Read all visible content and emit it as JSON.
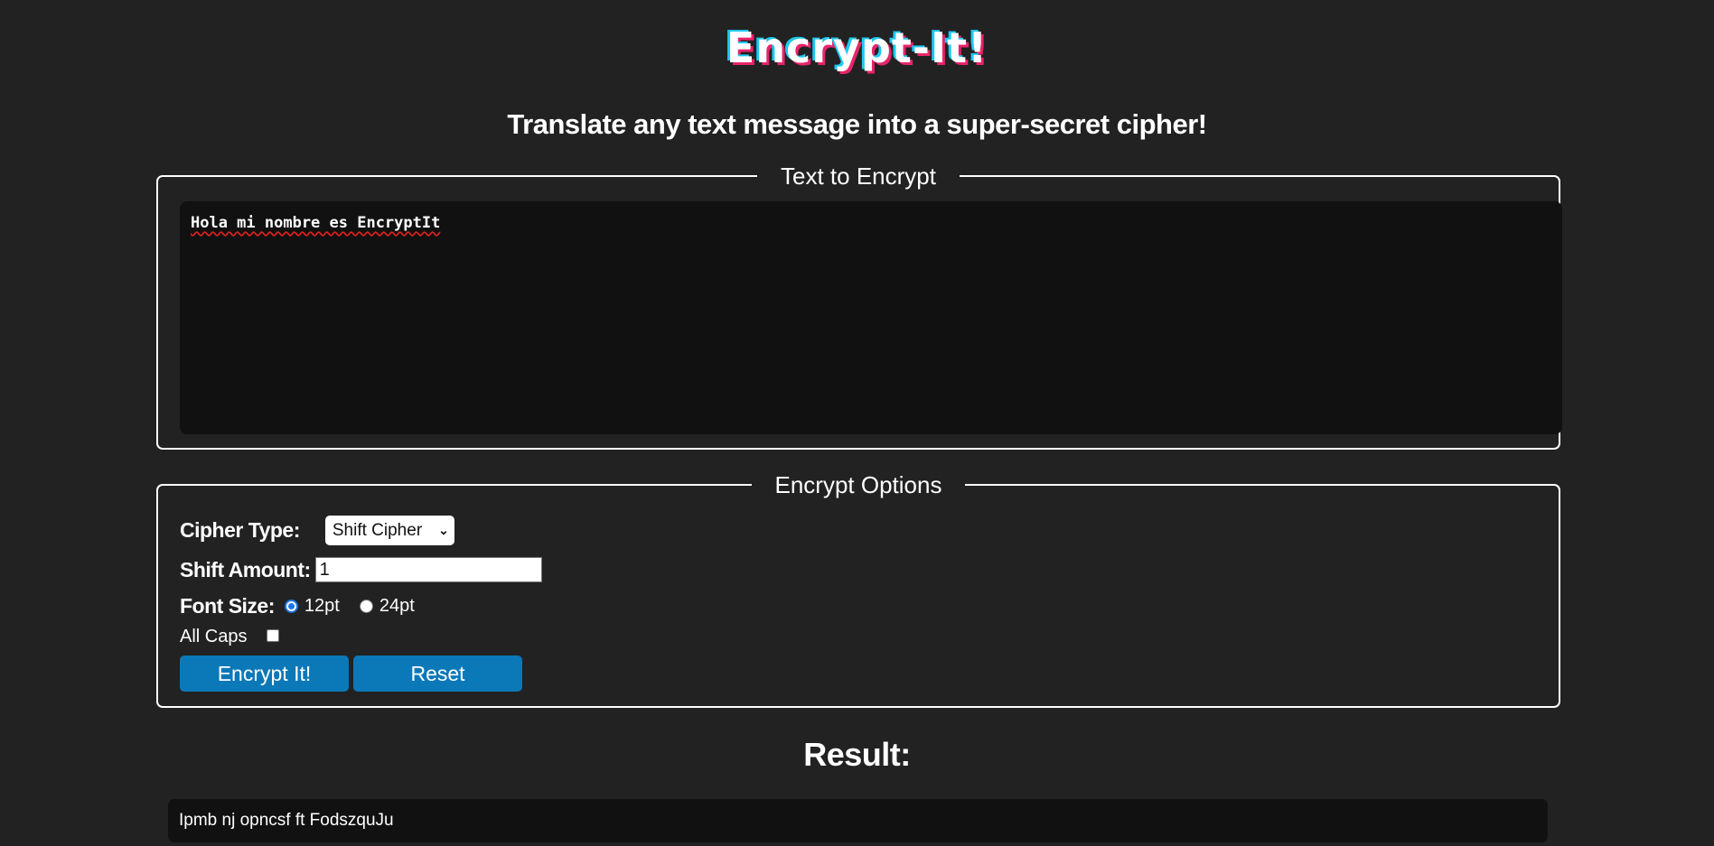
{
  "app": {
    "logo": "Encrypt-It!",
    "subtitle": "Translate any text message into a super-secret cipher!"
  },
  "colors": {
    "background": "#222222",
    "input_background": "#111111",
    "accent": "#0b78b8",
    "logo_shadow_cyan": "#1ec8f0",
    "logo_shadow_pink": "#e8246a"
  },
  "text_panel": {
    "legend": "Text to Encrypt",
    "value": "Hola mi nombre es EncryptIt"
  },
  "options_panel": {
    "legend": "Encrypt Options",
    "cipher_type": {
      "label": "Cipher Type:",
      "selected": "Shift Cipher",
      "icon": "chevron-down-icon"
    },
    "shift_amount": {
      "label": "Shift Amount:",
      "value": "1"
    },
    "font_size": {
      "label": "Font Size:",
      "options": [
        {
          "label": "12pt",
          "checked": true
        },
        {
          "label": "24pt",
          "checked": false
        }
      ]
    },
    "all_caps": {
      "label": "All Caps",
      "checked": false
    },
    "buttons": {
      "encrypt": "Encrypt It!",
      "reset": "Reset"
    }
  },
  "result": {
    "heading": "Result:",
    "value": "Ipmb nj opncsf ft FodszquJu"
  }
}
